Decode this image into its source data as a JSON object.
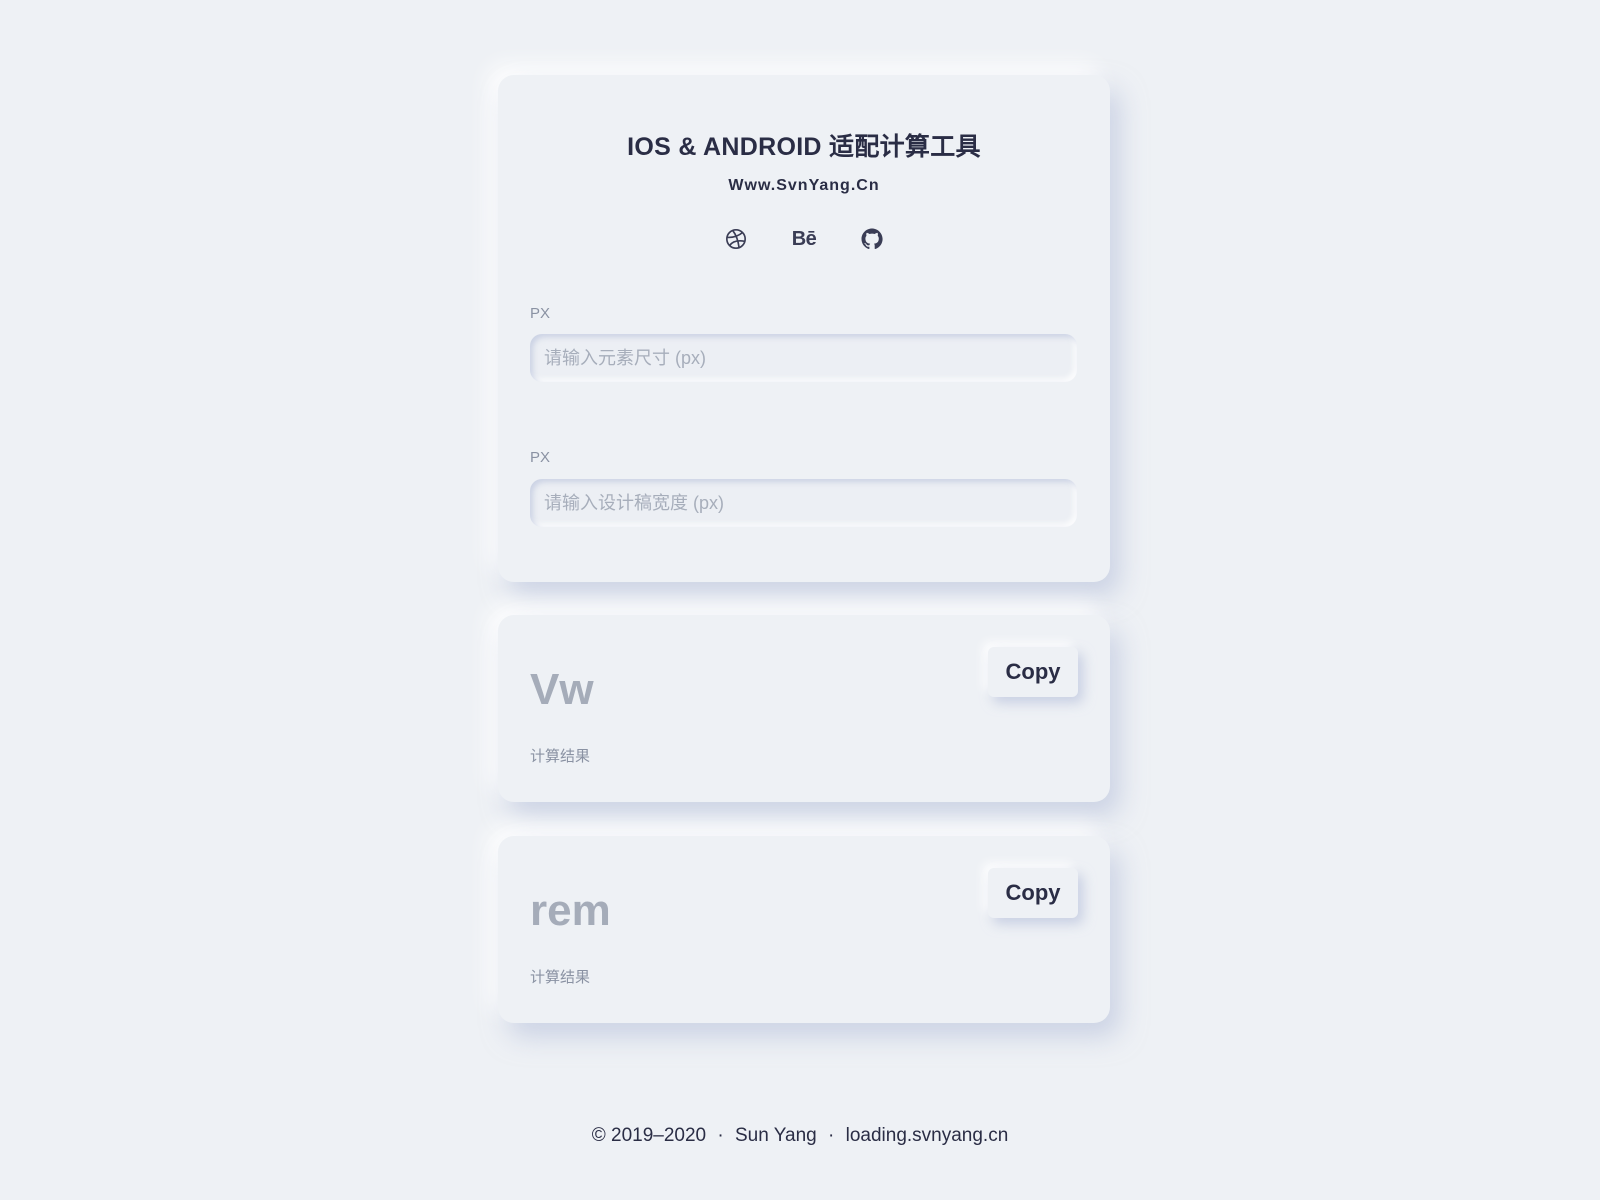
{
  "header": {
    "title": "IOS & ANDROID 适配计算工具",
    "subtitle": "Www.SvnYang.Cn"
  },
  "social": {
    "dribbble_icon": "dribbble-icon",
    "behance_label": "Bē",
    "github_icon": "github-icon"
  },
  "inputs": {
    "element_size": {
      "label": "PX",
      "value": "",
      "placeholder": "请输入元素尺寸 (px)"
    },
    "design_width": {
      "label": "PX",
      "value": "",
      "placeholder": "请输入设计稿宽度 (px)"
    }
  },
  "results": {
    "vw": {
      "unit": "Vw",
      "caption": "计算结果",
      "copy_label": "Copy"
    },
    "rem": {
      "unit": "rem",
      "caption": "计算结果",
      "copy_label": "Copy"
    }
  },
  "footer": {
    "copyright": "© 2019–2020",
    "separator": "·",
    "author": "Sun Yang",
    "site": "loading.svnyang.cn"
  },
  "colors": {
    "background": "#eef1f5",
    "text": "#2a2d45",
    "muted": "#8a92a3",
    "result_unit": "#a5acb9"
  }
}
